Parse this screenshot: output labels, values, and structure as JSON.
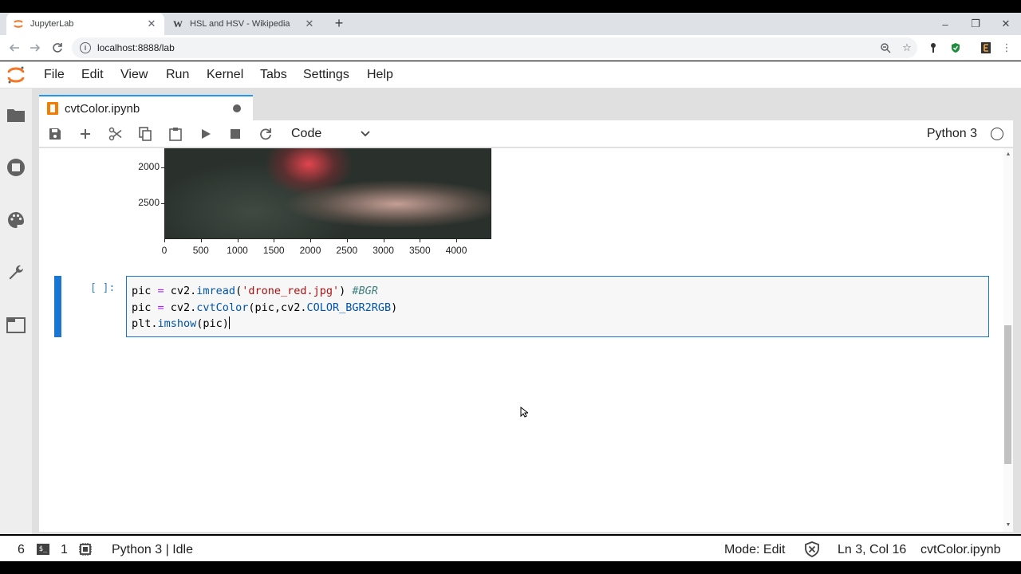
{
  "browser": {
    "tabs": [
      {
        "title": "JupyterLab",
        "active": true
      },
      {
        "title": "HSL and HSV - Wikipedia",
        "favicon_letter": "W",
        "active": false
      }
    ],
    "url": "localhost:8888/lab",
    "window_controls": {
      "minimize": "–",
      "restore": "❐",
      "close": "✕"
    }
  },
  "menubar": {
    "items": [
      "File",
      "Edit",
      "View",
      "Run",
      "Kernel",
      "Tabs",
      "Settings",
      "Help"
    ]
  },
  "document_tab": {
    "title": "cvtColor.ipynb",
    "modified": true
  },
  "notebook_toolbar": {
    "cell_type": "Code",
    "kernel_name": "Python 3"
  },
  "output_plot": {
    "y_ticks": [
      "2000",
      "2500"
    ],
    "x_ticks": [
      "0",
      "500",
      "1000",
      "1500",
      "2000",
      "2500",
      "3000",
      "3500",
      "4000"
    ]
  },
  "code_cell": {
    "prompt": "[ ]:",
    "lines": [
      [
        {
          "t": "pic",
          "c": "kw"
        },
        {
          "t": " = ",
          "c": "op"
        },
        {
          "t": "cv2.",
          "c": "kw"
        },
        {
          "t": "imread",
          "c": "fn"
        },
        {
          "t": "(",
          "c": "kw"
        },
        {
          "t": "'drone_red.jpg'",
          "c": "str"
        },
        {
          "t": ") ",
          "c": "kw"
        },
        {
          "t": "#BGR",
          "c": "cm"
        }
      ],
      [
        {
          "t": "pic",
          "c": "kw"
        },
        {
          "t": " = ",
          "c": "op"
        },
        {
          "t": "cv2.",
          "c": "kw"
        },
        {
          "t": "cvtColor",
          "c": "fn"
        },
        {
          "t": "(pic,cv2.",
          "c": "kw"
        },
        {
          "t": "COLOR_BGR2RGB",
          "c": "fn"
        },
        {
          "t": ")",
          "c": "kw"
        }
      ],
      [
        {
          "t": "plt.",
          "c": "kw"
        },
        {
          "t": "imshow",
          "c": "fn"
        },
        {
          "t": "(pic)",
          "c": "kw"
        }
      ]
    ]
  },
  "statusbar": {
    "count_left": "6",
    "terminal_count": "1",
    "kernel_status": "Python 3 | Idle",
    "mode": "Mode: Edit",
    "cursor_pos": "Ln 3, Col 16",
    "filename": "cvtColor.ipynb"
  }
}
